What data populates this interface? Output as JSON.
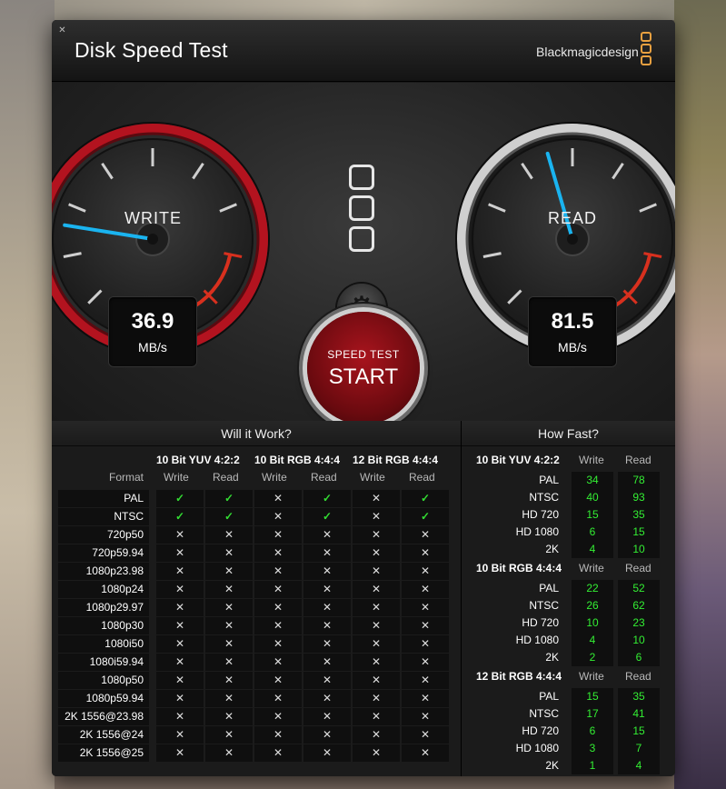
{
  "app": {
    "title": "Disk Speed Test",
    "brand": "Blackmagicdesign",
    "close_icon": "close-icon"
  },
  "gauges": {
    "write": {
      "label": "WRITE",
      "value": "36.9",
      "unit": "MB/s",
      "needle_fraction": 0.2
    },
    "read": {
      "label": "READ",
      "value": "81.5",
      "unit": "MB/s",
      "needle_fraction": 0.44
    }
  },
  "start_button": {
    "top_label": "SPEED TEST",
    "label": "START"
  },
  "colors": {
    "write_ring": "#b3131f",
    "needle": "#1ab4f0",
    "ok_check": "#33dd33",
    "speed_value": "#33ee33",
    "brand_logo": "#e8a040"
  },
  "will_it_work": {
    "title": "Will it Work?",
    "format_label": "Format",
    "groups": [
      "10 Bit YUV 4:2:2",
      "10 Bit RGB 4:4:4",
      "12 Bit RGB 4:4:4"
    ],
    "sub_cols": [
      "Write",
      "Read",
      "Write",
      "Read",
      "Write",
      "Read"
    ],
    "rows": [
      {
        "format": "PAL",
        "cells": [
          "✓",
          "✓",
          "✕",
          "✓",
          "✕",
          "✓"
        ]
      },
      {
        "format": "NTSC",
        "cells": [
          "✓",
          "✓",
          "✕",
          "✓",
          "✕",
          "✓"
        ]
      },
      {
        "format": "720p50",
        "cells": [
          "✕",
          "✕",
          "✕",
          "✕",
          "✕",
          "✕"
        ]
      },
      {
        "format": "720p59.94",
        "cells": [
          "✕",
          "✕",
          "✕",
          "✕",
          "✕",
          "✕"
        ]
      },
      {
        "format": "1080p23.98",
        "cells": [
          "✕",
          "✕",
          "✕",
          "✕",
          "✕",
          "✕"
        ]
      },
      {
        "format": "1080p24",
        "cells": [
          "✕",
          "✕",
          "✕",
          "✕",
          "✕",
          "✕"
        ]
      },
      {
        "format": "1080p29.97",
        "cells": [
          "✕",
          "✕",
          "✕",
          "✕",
          "✕",
          "✕"
        ]
      },
      {
        "format": "1080p30",
        "cells": [
          "✕",
          "✕",
          "✕",
          "✕",
          "✕",
          "✕"
        ]
      },
      {
        "format": "1080i50",
        "cells": [
          "✕",
          "✕",
          "✕",
          "✕",
          "✕",
          "✕"
        ]
      },
      {
        "format": "1080i59.94",
        "cells": [
          "✕",
          "✕",
          "✕",
          "✕",
          "✕",
          "✕"
        ]
      },
      {
        "format": "1080p50",
        "cells": [
          "✕",
          "✕",
          "✕",
          "✕",
          "✕",
          "✕"
        ]
      },
      {
        "format": "1080p59.94",
        "cells": [
          "✕",
          "✕",
          "✕",
          "✕",
          "✕",
          "✕"
        ]
      },
      {
        "format": "2K 1556@23.98",
        "cells": [
          "✕",
          "✕",
          "✕",
          "✕",
          "✕",
          "✕"
        ]
      },
      {
        "format": "2K 1556@24",
        "cells": [
          "✕",
          "✕",
          "✕",
          "✕",
          "✕",
          "✕"
        ]
      },
      {
        "format": "2K 1556@25",
        "cells": [
          "✕",
          "✕",
          "✕",
          "✕",
          "✕",
          "✕"
        ]
      }
    ]
  },
  "how_fast": {
    "title": "How Fast?",
    "write_label": "Write",
    "read_label": "Read",
    "groups": [
      {
        "name": "10 Bit YUV 4:2:2",
        "rows": [
          {
            "format": "PAL",
            "write": "34",
            "read": "78"
          },
          {
            "format": "NTSC",
            "write": "40",
            "read": "93"
          },
          {
            "format": "HD 720",
            "write": "15",
            "read": "35"
          },
          {
            "format": "HD 1080",
            "write": "6",
            "read": "15"
          },
          {
            "format": "2K",
            "write": "4",
            "read": "10"
          }
        ]
      },
      {
        "name": "10 Bit RGB 4:4:4",
        "rows": [
          {
            "format": "PAL",
            "write": "22",
            "read": "52"
          },
          {
            "format": "NTSC",
            "write": "26",
            "read": "62"
          },
          {
            "format": "HD 720",
            "write": "10",
            "read": "23"
          },
          {
            "format": "HD 1080",
            "write": "4",
            "read": "10"
          },
          {
            "format": "2K",
            "write": "2",
            "read": "6"
          }
        ]
      },
      {
        "name": "12 Bit RGB 4:4:4",
        "rows": [
          {
            "format": "PAL",
            "write": "15",
            "read": "35"
          },
          {
            "format": "NTSC",
            "write": "17",
            "read": "41"
          },
          {
            "format": "HD 720",
            "write": "6",
            "read": "15"
          },
          {
            "format": "HD 1080",
            "write": "3",
            "read": "7"
          },
          {
            "format": "2K",
            "write": "1",
            "read": "4"
          }
        ]
      }
    ]
  }
}
